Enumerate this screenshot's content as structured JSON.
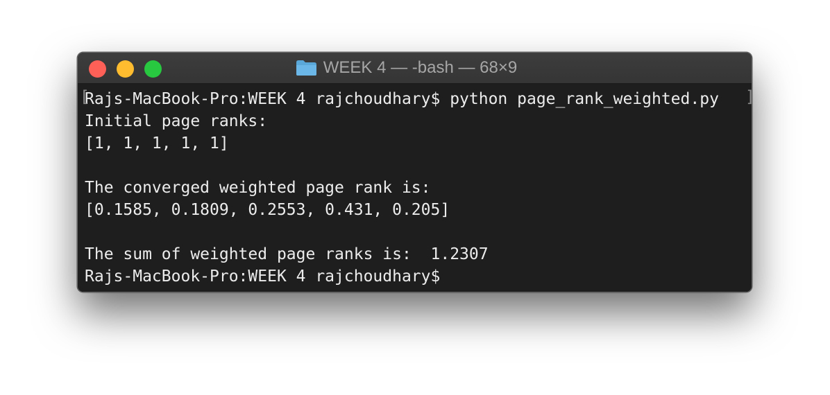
{
  "window": {
    "title": "WEEK 4 — -bash — 68×9",
    "folder_icon": "folder-icon",
    "colors": {
      "close": "#fe5f57",
      "minimize": "#febc2e",
      "maximize": "#28c840",
      "background": "#1e1e1e",
      "text": "#ececec"
    }
  },
  "terminal": {
    "bracket_left": "[",
    "bracket_right": "]",
    "lines": [
      "Rajs-MacBook-Pro:WEEK 4 rajchoudhary$ python page_rank_weighted.py",
      "Initial page ranks:",
      "[1, 1, 1, 1, 1]",
      "",
      "The converged weighted page rank is:",
      "[0.1585, 0.1809, 0.2553, 0.431, 0.205]",
      "",
      "The sum of weighted page ranks is:  1.2307",
      "Rajs-MacBook-Pro:WEEK 4 rajchoudhary$"
    ]
  }
}
